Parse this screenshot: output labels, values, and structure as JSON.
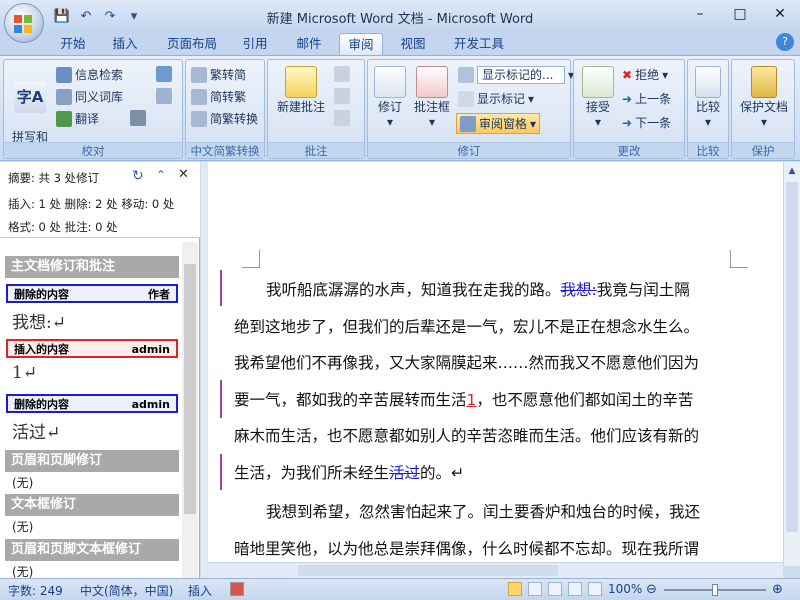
{
  "window": {
    "title": "新建 Microsoft Word 文档 - Microsoft Word",
    "minimize": "–",
    "maximize": "□",
    "close": "✕"
  },
  "qat": {
    "save": "💾",
    "undo": "↶",
    "redo": "↷",
    "more": "▾"
  },
  "tabs": [
    "开始",
    "插入",
    "页面布局",
    "引用",
    "邮件",
    "审阅",
    "视图",
    "开发工具"
  ],
  "active_tab": "审阅",
  "help": "?",
  "ribbon": {
    "proof": {
      "label": "校对",
      "spelling": "拼写和\n语法",
      "research": "信息检索",
      "thesaurus": "同义词库",
      "translate": "翻译"
    },
    "chinese": {
      "label": "中文简繁转换",
      "to_trad": "繁转简",
      "to_simp": "简转繁",
      "convert": "简繁转换"
    },
    "comments": {
      "label": "批注",
      "new": "新建批注"
    },
    "tracking": {
      "label": "修订",
      "track": "修订",
      "balloons": "批注框",
      "display_for_review": "显示标记的...",
      "show_markup": "显示标记",
      "review_pane": "审阅窗格"
    },
    "changes": {
      "label": "更改",
      "accept": "接受",
      "reject": "拒绝",
      "previous": "上一条",
      "next": "下一条"
    },
    "compare": {
      "label": "比较",
      "btn": "比较"
    },
    "protect": {
      "label": "保护",
      "btn": "保护文档"
    }
  },
  "review_pane": {
    "summary": "摘要: 共 3 处修订",
    "counts1": "插入: 1 处  删除: 2 处  移动: 0 处",
    "counts2": "格式: 0 处  批注: 0 处",
    "main_section": "主文档修订和批注",
    "revisions": [
      {
        "type": "删除的内容",
        "author": "作者",
        "text": "我想:↵"
      },
      {
        "type": "插入的内容",
        "author": "admin",
        "text": "1↵"
      },
      {
        "type": "删除的内容",
        "author": "admin",
        "text": "活过↵"
      }
    ],
    "header_footer": "页眉和页脚修订",
    "none": "(无)",
    "textbox": "文本框修订",
    "hf_textbox": "页眉和页脚文本框修订"
  },
  "document": {
    "p1_line1_a": "我听船底潺潺的水声，知道我在走我的路。",
    "p1_line1_del": "我想:",
    "p1_line1_b": "我竟与闰土隔",
    "p1_line2": "绝到这地步了，但我们的后辈还是一气，宏儿不是正在想念水生么。",
    "p1_line3": "我希望他们不再像我，又大家隔膜起来……然而我又不愿意他们因为",
    "p1_line4_a": "要一气，都如我的辛苦展转而生活",
    "p1_line4_ins": "1",
    "p1_line4_b": "，也不愿意他们都如闰土的辛苦",
    "p1_line5": "麻木而生活，也不愿意都如别人的辛苦恣睢而生活。他们应该有新的",
    "p1_line6_a": "生活，为我们所未经生",
    "p1_line6_del": "活过",
    "p1_line6_b": "的。↵",
    "p2_line1": "我想到希望，忽然害怕起来了。闰土要香炉和烛台的时候，我还",
    "p2_line2": "暗地里笑他，以为他总是崇拜偶像，什么时候都不忘却。现在我所谓"
  },
  "status": {
    "words": "字数: 249",
    "language": "中文(简体，中国)",
    "mode": "插入",
    "zoom": "100%"
  },
  "colors": {
    "deletion": "#1b1bd6",
    "insertion": "#e0232a",
    "change_bar": "#b23aa6"
  }
}
